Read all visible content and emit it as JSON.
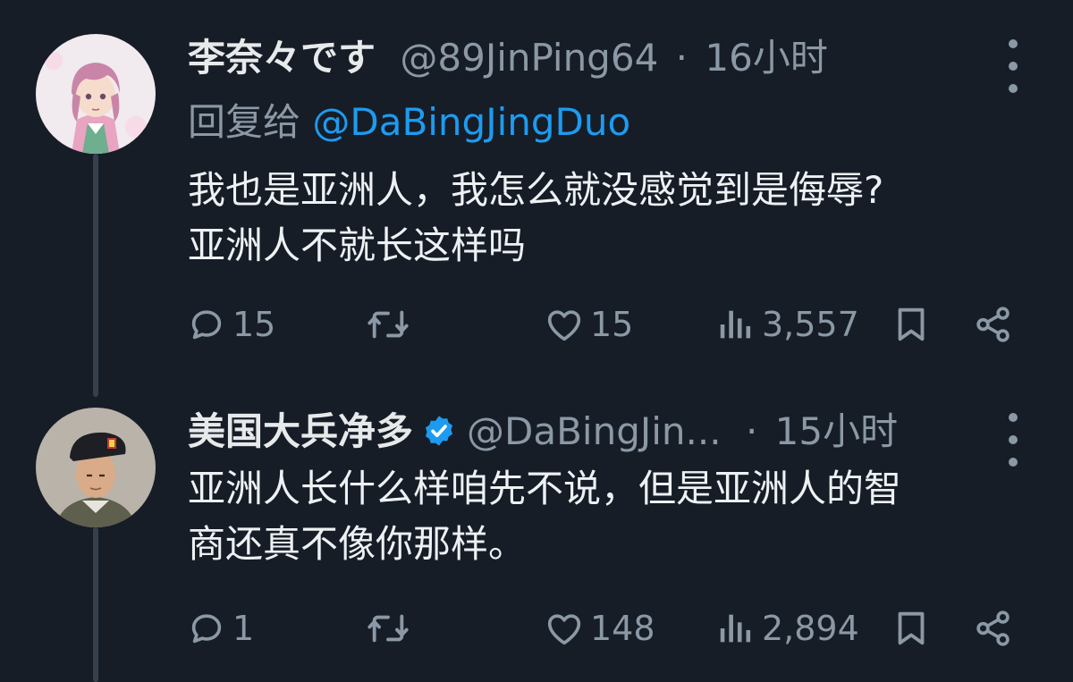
{
  "tweets": [
    {
      "display_name": "李奈々です",
      "handle": "@89JinPing64",
      "separator": "·",
      "time": "16小时",
      "reply_label": "回复给",
      "reply_mention": "@DaBingJingDuo",
      "text": "我也是亚洲人，我怎么就没感觉到是侮辱?\n亚洲人不就长这样吗",
      "replies": "15",
      "retweets": "",
      "likes": "15",
      "views": "3,557",
      "verified": false
    },
    {
      "display_name": "美国大兵净多",
      "handle": "@DaBingJin...",
      "separator": "·",
      "time": "15小时",
      "text": "亚洲人长什么样咱先不说，但是亚洲人的智\n商还真不像你那样。",
      "replies": "1",
      "retweets": "",
      "likes": "148",
      "views": "2,894",
      "verified": true
    }
  ],
  "colors": {
    "background": "#161d27",
    "text_primary": "#e7e9ea",
    "text_secondary": "#8b98a5",
    "link": "#1d9bf0",
    "verified_badge": "#1d9bf0",
    "thread_line": "#36404d"
  },
  "icons": [
    "reply-icon",
    "retweet-icon",
    "like-icon",
    "views-icon",
    "bookmark-icon",
    "share-icon",
    "more-icon",
    "verified-badge-icon"
  ]
}
